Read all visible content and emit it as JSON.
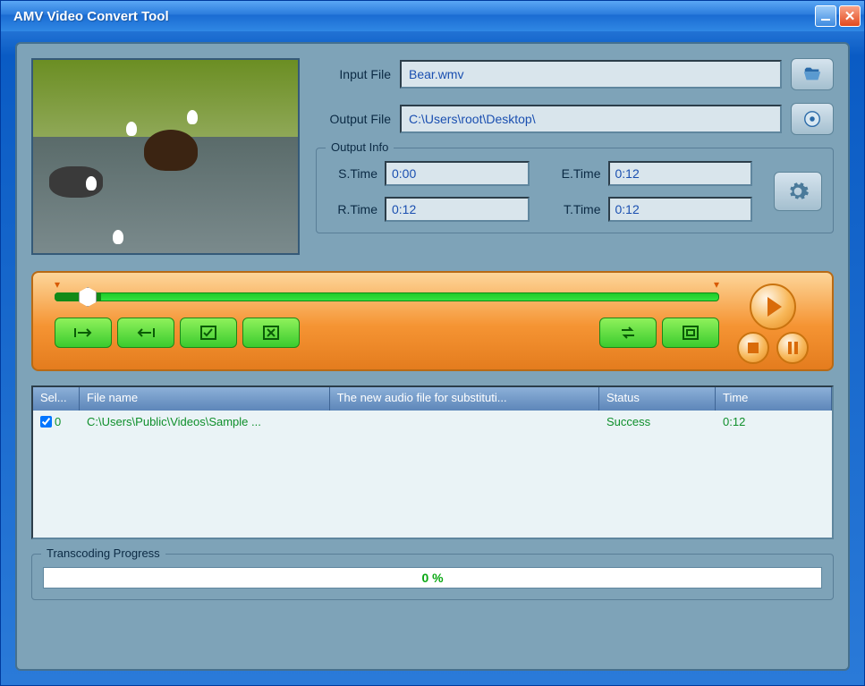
{
  "window": {
    "title": "AMV Video Convert Tool"
  },
  "files": {
    "input_label": "Input File",
    "input_value": "Bear.wmv",
    "output_label": "Output File",
    "output_value": "C:\\Users\\root\\Desktop\\"
  },
  "output_info": {
    "legend": "Output Info",
    "s_time_label": "S.Time",
    "s_time": "0:00",
    "e_time_label": "E.Time",
    "e_time": "0:12",
    "r_time_label": "R.Time",
    "r_time": "0:12",
    "t_time_label": "T.Time",
    "t_time": "0:12"
  },
  "table": {
    "headers": {
      "select": "Sel...",
      "filename": "File name",
      "substitution": "The new audio file for substituti...",
      "status": "Status",
      "time": "Time"
    },
    "rows": [
      {
        "checked": true,
        "index": "0",
        "filename": "C:\\Users\\Public\\Videos\\Sample ...",
        "substitution": "",
        "status": "Success",
        "time": "0:12"
      }
    ]
  },
  "progress": {
    "legend": "Transcoding Progress",
    "text": "0 %"
  }
}
